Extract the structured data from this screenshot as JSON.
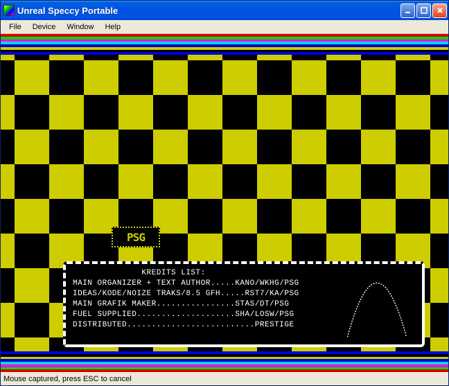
{
  "window": {
    "title": "Unreal Speccy Portable"
  },
  "menu": {
    "items": [
      "File",
      "Device",
      "Window",
      "Help"
    ]
  },
  "stripes": {
    "colors": [
      "#d70000",
      "#00d700",
      "#ff00ff",
      "#00d7d7",
      "#0000d7",
      "#cdcd00",
      "#000000",
      "#0000d7"
    ]
  },
  "logo": {
    "text": "PSG"
  },
  "credits": {
    "title": "KREDITS LIST:",
    "lines": [
      "MAIN ORGANIZER + TEXT AUTHOR.....KANO/WKHG/PSG",
      "IDEAS/KODE/NOIZE TRAKS/8.5 GFH.....RST7/KA/PSG",
      "MAIN GRAFIK MAKER................STAS/DT/PSG",
      "FUEL SUPPLIED....................SHA/LOSW/PSG",
      "DISTRIBUTED..........................PRESTIGE"
    ]
  },
  "status": {
    "text": "Mouse captured, press ESC to cancel"
  }
}
